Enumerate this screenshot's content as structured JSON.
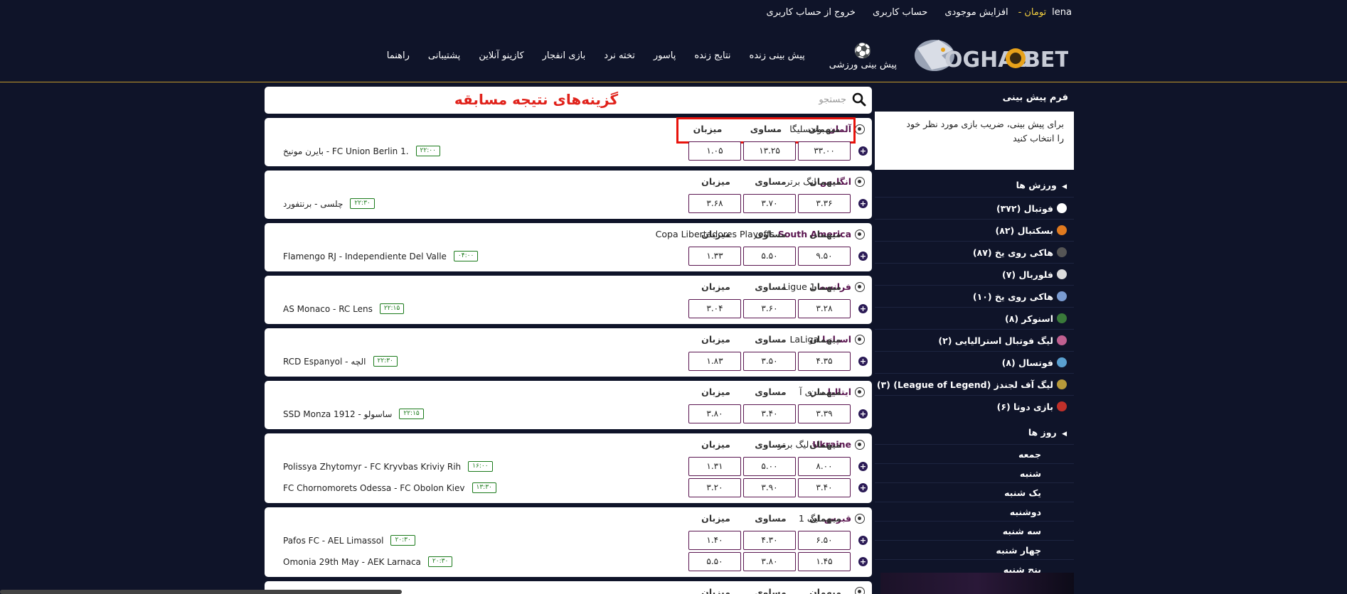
{
  "topbar": {
    "username": "lena",
    "currency": "تومان",
    "separator": "-",
    "increase_balance": "افزایش موجودی",
    "account": "حساب کاربری",
    "logout": "خروج از حساب کاربری"
  },
  "logo": {
    "text_left": "OGHAB",
    "text_right": "BET"
  },
  "nav": {
    "sports_prediction": "پیش بینی ورزشی",
    "live_prediction": "پیش بینی زنده",
    "live_results": "نتایج زنده",
    "passor": "پاسور",
    "backgammon": "تخته نرد",
    "crash": "بازی انفجار",
    "casino": "کازینو آنلاین",
    "support": "پشتیبانی",
    "guide": "راهنما"
  },
  "sidebar": {
    "title": "فرم پیش بینی",
    "help": "برای پیش بینی، ضریب بازی مورد نظر خود را انتخاب کنید",
    "sports_heading": "ورزش ها",
    "sports": [
      {
        "label": "فوتبال (۳۷۲)",
        "icon": "soccer-icon",
        "color": "#ffffff"
      },
      {
        "label": "بسکتبال (۸۲)",
        "icon": "basketball-icon",
        "color": "#e07a1f"
      },
      {
        "label": "هاکی روی یخ (۸۷)",
        "icon": "hockey-puck-icon",
        "color": "#555555"
      },
      {
        "label": "فلوربال (۷)",
        "icon": "floorball-icon",
        "color": "#dddddd"
      },
      {
        "label": "هاکی روی یخ (۱۰)",
        "icon": "hockey-stick-icon",
        "color": "#7a9bd1"
      },
      {
        "label": "اسنوکر (۸)",
        "icon": "snooker-icon",
        "color": "#3a7a3a"
      },
      {
        "label": "لیگ فوتبال استرالیایی (۲)",
        "icon": "afl-icon",
        "color": "#c06090"
      },
      {
        "label": "فوتسال (۸)",
        "icon": "futsal-icon",
        "color": "#5aa0d0"
      },
      {
        "label": "لیگ آف لجندز (League of Legend) (۳)",
        "icon": "lol-icon",
        "color": "#b89a3a"
      },
      {
        "label": "بازی دوتا (۶)",
        "icon": "dota-icon",
        "color": "#c0302a"
      }
    ],
    "days_heading": "روز ها",
    "days": [
      "جمعه",
      "شنبه",
      "یک شنبه",
      "دوشنبه",
      "سه شنبه",
      "چهار شنبه",
      "پنج شنبه"
    ]
  },
  "search": {
    "placeholder": "جستجو",
    "title": "گزینه‌های نتیجه مسابقه"
  },
  "odds_labels": {
    "away": "میهمان",
    "draw": "مساوی",
    "home": "میزبان"
  },
  "cards": [
    {
      "country": "آلمان",
      "league": "بوندسلیگا",
      "highlight": true,
      "matches": [
        {
          "teams": "بایرن مونیخ  -  FC Union Berlin 1.",
          "time": "۲۲:۰۰",
          "away": "۳۳.۰۰",
          "draw": "۱۳.۲۵",
          "home": "۱.۰۵"
        }
      ]
    },
    {
      "country": "انگلیس",
      "league": "لیگ برتر",
      "matches": [
        {
          "teams": "چلسی  -  برنتفورد",
          "time": "۲۲:۳۰",
          "away": "۳.۳۶",
          "draw": "۳.۷۰",
          "home": "۳.۶۸"
        }
      ]
    },
    {
      "country": "South America",
      "league": "Copa Libertadores Playoffs",
      "matches": [
        {
          "teams": "Flamengo RJ  -  Independiente Del Valle",
          "time": "۰۴:۰۰",
          "away": "۹.۵۰",
          "draw": "۵.۵۰",
          "home": "۱.۳۳"
        }
      ]
    },
    {
      "country": "فرانسه",
      "league": "Ligue 1",
      "matches": [
        {
          "teams": "AS Monaco  -  RC Lens",
          "time": "۲۲:۱۵",
          "away": "۳.۲۸",
          "draw": "۳.۶۰",
          "home": "۳.۰۴"
        }
      ]
    },
    {
      "country": "اسپانیا",
      "league": "LaLiga",
      "matches": [
        {
          "teams": "RCD Espanyol  -  الچه",
          "time": "۲۲:۳۰",
          "away": "۴.۳۵",
          "draw": "۳.۵۰",
          "home": "۱.۸۳"
        }
      ]
    },
    {
      "country": "ایتالیا",
      "league": "سری آ",
      "matches": [
        {
          "teams": "SSD Monza 1912  -  ساسولو",
          "time": "۲۲:۱۵",
          "away": "۳.۳۹",
          "draw": "۳.۴۰",
          "home": "۳.۸۰"
        }
      ]
    },
    {
      "country": "Ukraine",
      "league": "لیگ برتر",
      "matches": [
        {
          "teams": "Polissya Zhytomyr  -  FC Kryvbas Kriviy Rih",
          "time": "۱۶:۰۰",
          "away": "۸.۰۰",
          "draw": "۵.۰۰",
          "home": "۱.۳۱"
        },
        {
          "teams": "FC Chornomorets Odessa  -  FC Obolon Kiev",
          "time": "۱۳:۳۰",
          "away": "۳.۴۰",
          "draw": "۳.۹۰",
          "home": "۳.۲۰"
        }
      ]
    },
    {
      "country": "قبرس",
      "league": "لیگ 1",
      "matches": [
        {
          "teams": "Pafos FC  -  AEL Limassol",
          "time": "۲۰:۳۰",
          "away": "۶.۵۰",
          "draw": "۴.۳۰",
          "home": "۱.۴۰"
        },
        {
          "teams": "Omonia 29th May  -  AEK Larnaca",
          "time": "۲۰:۳۰",
          "away": "۱.۴۵",
          "draw": "۳.۸۰",
          "home": "۵.۵۰"
        }
      ]
    },
    {
      "country": "",
      "league": "",
      "partial": true,
      "matches": []
    }
  ]
}
